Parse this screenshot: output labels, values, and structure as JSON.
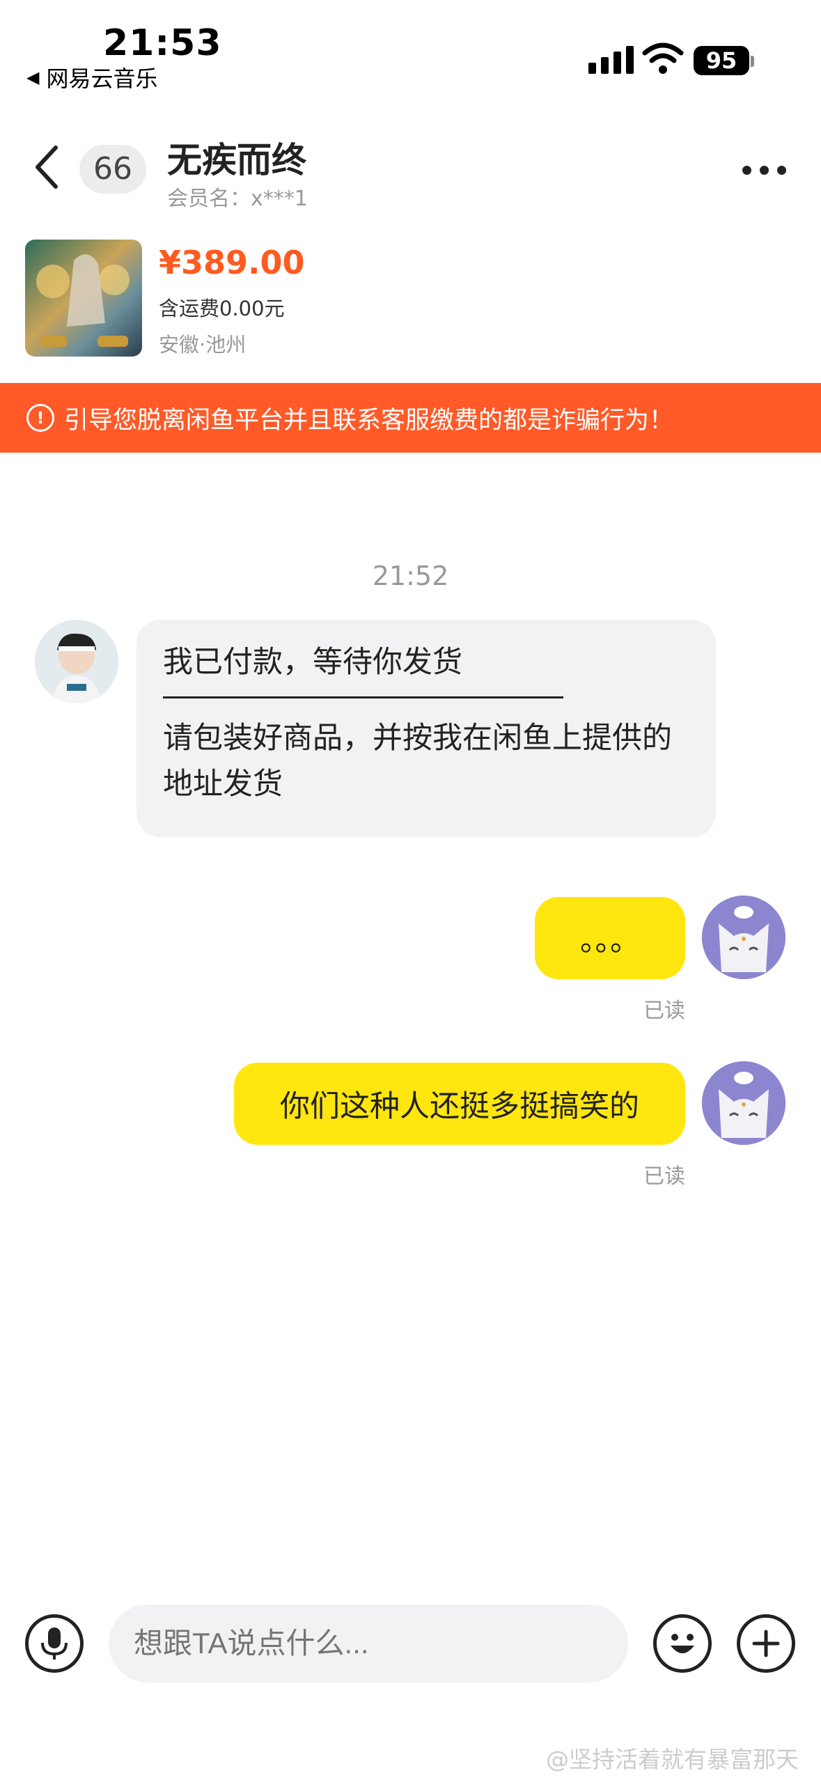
{
  "status_bar": {
    "time": "21:53",
    "back_app": "网易云音乐",
    "battery": "95"
  },
  "header": {
    "unread_count": "66",
    "title": "无疾而终",
    "subtitle": "会员名：x***1"
  },
  "product": {
    "price": "¥389.00",
    "shipping": "含运费0.00元",
    "location": "安徽·池州"
  },
  "warning": {
    "text": "引导您脱离闲鱼平台并且联系客服缴费的都是诈骗行为！"
  },
  "chat": {
    "timestamp": "21:52",
    "incoming": {
      "line1": "我已付款，等待你发货",
      "line2": "请包装好商品，并按我在闲鱼上提供的地址发货"
    },
    "outgoing": [
      {
        "text": "。。。",
        "status": "已读"
      },
      {
        "text": "你们这种人还挺多挺搞笑的",
        "status": "已读"
      }
    ]
  },
  "input": {
    "placeholder": "想跟TA说点什么..."
  },
  "watermark": "@坚持活着就有暴富那天",
  "colors": {
    "accent_orange": "#ff5a28",
    "price_orange": "#ff5a1f",
    "bubble_yellow": "#ffe60f",
    "bubble_gray": "#f2f2f4"
  }
}
